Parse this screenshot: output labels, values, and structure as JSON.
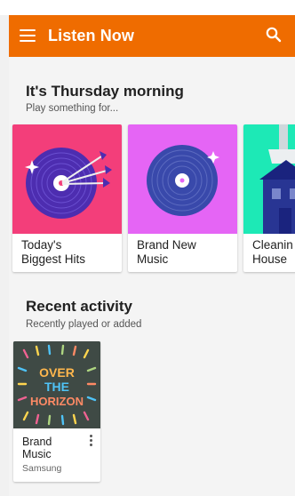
{
  "app": {
    "title": "Listen Now",
    "accent_color": "#ef6c00",
    "menu_icon": "hamburger-menu-icon",
    "search_icon": "search-icon"
  },
  "section_suggestions": {
    "title": "It's Thursday morning",
    "subtitle": "Play something for...",
    "cards": [
      {
        "label": "Today's Biggest Hits",
        "line1": "Today's",
        "line2": "Biggest Hits",
        "art_color": "#f33e7a"
      },
      {
        "label": "Brand New Music",
        "line1": "Brand New",
        "line2": "Music",
        "art_color": "#e565f5"
      },
      {
        "label": "Cleaning House",
        "line1": "Cleanin",
        "line2": "House",
        "art_color": "#1de9b6"
      }
    ]
  },
  "section_recent": {
    "title": "Recent activity",
    "subtitle": "Recently played or added",
    "albums": [
      {
        "title": "Brand Music",
        "title_line1": "Brand",
        "title_line2": "Music",
        "artist": "Samsung",
        "art_text": [
          "OVER",
          "THE",
          "HORIZON"
        ]
      }
    ]
  }
}
